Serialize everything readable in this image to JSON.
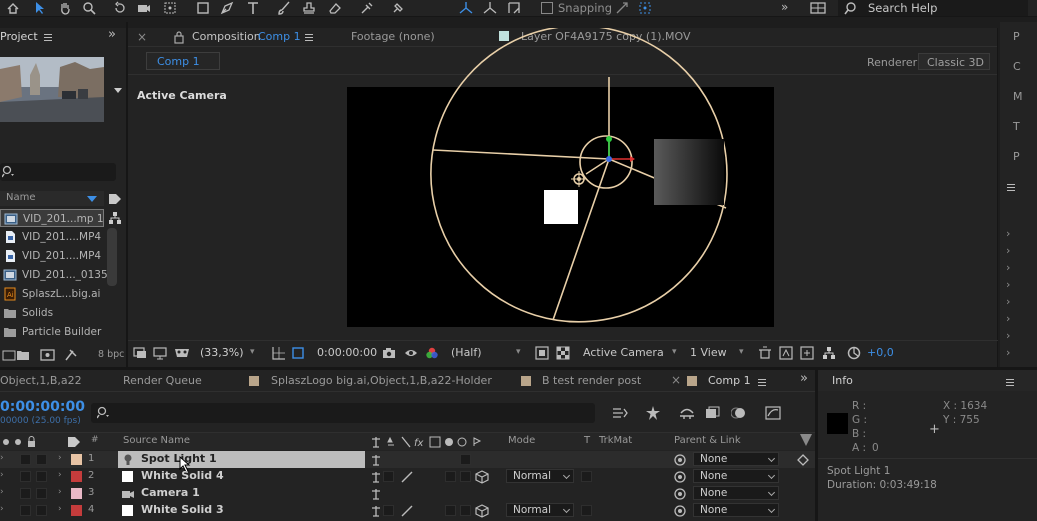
{
  "toolbar": {
    "snapping_label": "Snapping",
    "search_help_label": "Search Help"
  },
  "project": {
    "tab_label": "Project",
    "search_placeholder": "",
    "column_name": "Name",
    "files": [
      {
        "label": "VID_201...mp 1",
        "type": "comp"
      },
      {
        "label": "VID_201....MP4",
        "type": "video"
      },
      {
        "label": "VID_201....MP4",
        "type": "video"
      },
      {
        "label": "VID_201..._0135",
        "type": "comp"
      },
      {
        "label": "SplaszL...big.ai",
        "type": "ai"
      },
      {
        "label": "Solids",
        "type": "folder"
      },
      {
        "label": "Particle Builder",
        "type": "folder"
      }
    ],
    "bpc_label": "8 bpc"
  },
  "composition": {
    "tab_prefix": "Composition",
    "tab_comp": "Comp 1",
    "footage_tab": "Footage  (none)",
    "layer_tab": "Layer  OF4A9175 copy (1).MOV",
    "subtab": "Comp 1",
    "renderer_label": "Renderer:",
    "renderer_value": "Classic 3D",
    "active_camera": "Active Camera",
    "zoom": "(33,3%)",
    "timecode": "0:00:00:00",
    "resolution": "(Half)",
    "view": "Active Camera",
    "views": "1 View",
    "exposure": "+0,0"
  },
  "right_strip": {
    "letters": [
      "P",
      "C",
      "M",
      "T",
      "P"
    ]
  },
  "timeline": {
    "tabs": [
      {
        "label": "Object,1,B,a22",
        "color": ""
      },
      {
        "label": "Render Queue",
        "color": ""
      },
      {
        "label": "SplaszLogo big.ai,Object,1,B,a22-Holder",
        "color": "#b9a58a"
      },
      {
        "label": "B test render post",
        "color": "#b9a58a"
      },
      {
        "label": "Comp 1",
        "color": "#b9a58a"
      }
    ],
    "timecode": "0:00:00:00",
    "fps": "00000 (25.00 fps)",
    "col_source_name": "Source Name",
    "col_mode": "Mode",
    "col_t": "T",
    "col_trkmat": "TrkMat",
    "col_parent": "Parent & Link",
    "layers": [
      {
        "num": "1",
        "name": "Spot Light 1",
        "color": "#e7c3a4",
        "mode": "",
        "parent": "None",
        "selected": true
      },
      {
        "num": "2",
        "name": "White Solid 4",
        "color": "#c43c3c",
        "mode": "Normal",
        "parent": "None",
        "selected": false
      },
      {
        "num": "3",
        "name": "Camera 1",
        "color": "#e8b8c6",
        "mode": "",
        "parent": "None",
        "selected": false
      },
      {
        "num": "4",
        "name": "White Solid 3",
        "color": "#c43c3c",
        "mode": "Normal",
        "parent": "None",
        "selected": false
      }
    ]
  },
  "info": {
    "title": "Info",
    "r_label": "R :",
    "g_label": "G :",
    "b_label": "B :",
    "a_label": "A :",
    "a_value": "0",
    "x_label": "X : 1634",
    "y_label": "Y : 755",
    "layer_name": "Spot Light 1",
    "duration": "Duration: 0:03:49:18"
  },
  "colors": {
    "accent_blue": "#3d8fe6",
    "panel_bg": "#232323",
    "light_wire": "#e8cfa8"
  }
}
